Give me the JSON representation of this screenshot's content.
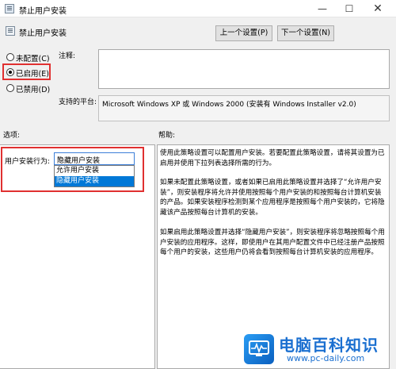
{
  "window": {
    "title": "禁止用户安装",
    "minimize": "—",
    "maximize": "☐",
    "close": "✕"
  },
  "policy": {
    "name": "禁止用户安装"
  },
  "nav": {
    "prev": "上一个设置(P)",
    "next": "下一个设置(N)"
  },
  "state": {
    "options": [
      "未配置(C)",
      "已启用(E)",
      "已禁用(D)"
    ],
    "selected": "已启用(E)"
  },
  "fields": {
    "comment_label": "注释:",
    "comment_value": "",
    "platform_label": "支持的平台:",
    "platform_value": "Microsoft Windows XP 或 Windows 2000 (安装有 Windows Installer v2.0)"
  },
  "options_panel": {
    "heading": "选项:",
    "behavior_label": "用户安装行为:",
    "selected_value": "隐藏用户安装",
    "dropdown_items": [
      "允许用户安装",
      "隐藏用户安装"
    ]
  },
  "help_panel": {
    "heading": "帮助:",
    "paragraphs": [
      "使用此策略设置可以配置用户安装。若要配置此策略设置，请将其设置为已启用并使用下拉列表选择所需的行为。",
      "如果未配置此策略设置，或者如果已启用此策略设置并选择了“允许用户安装”，则安装程序将允许并使用按照每个用户安装的和按照每台计算机安装的产品。如果安装程序检测到某个应用程序是按照每个用户安装的，它将隐藏该产品按照每台计算机的安装。",
      "如果启用此策略设置并选择“隐藏用户安装”，则安装程序将忽略按照每个用户安装的应用程序。这样，即使用户在其用户配置文件中已经注册产品按照每个用户的安装，这些用户仍将会看到按照每台计算机安装的应用程序。"
    ]
  },
  "watermark": {
    "title": "电脑百科知识",
    "url": "www.pc-daily.com"
  },
  "colors": {
    "highlight_box": "#e03030",
    "selection": "#0078d7",
    "watermark": "#1a6fd0"
  }
}
